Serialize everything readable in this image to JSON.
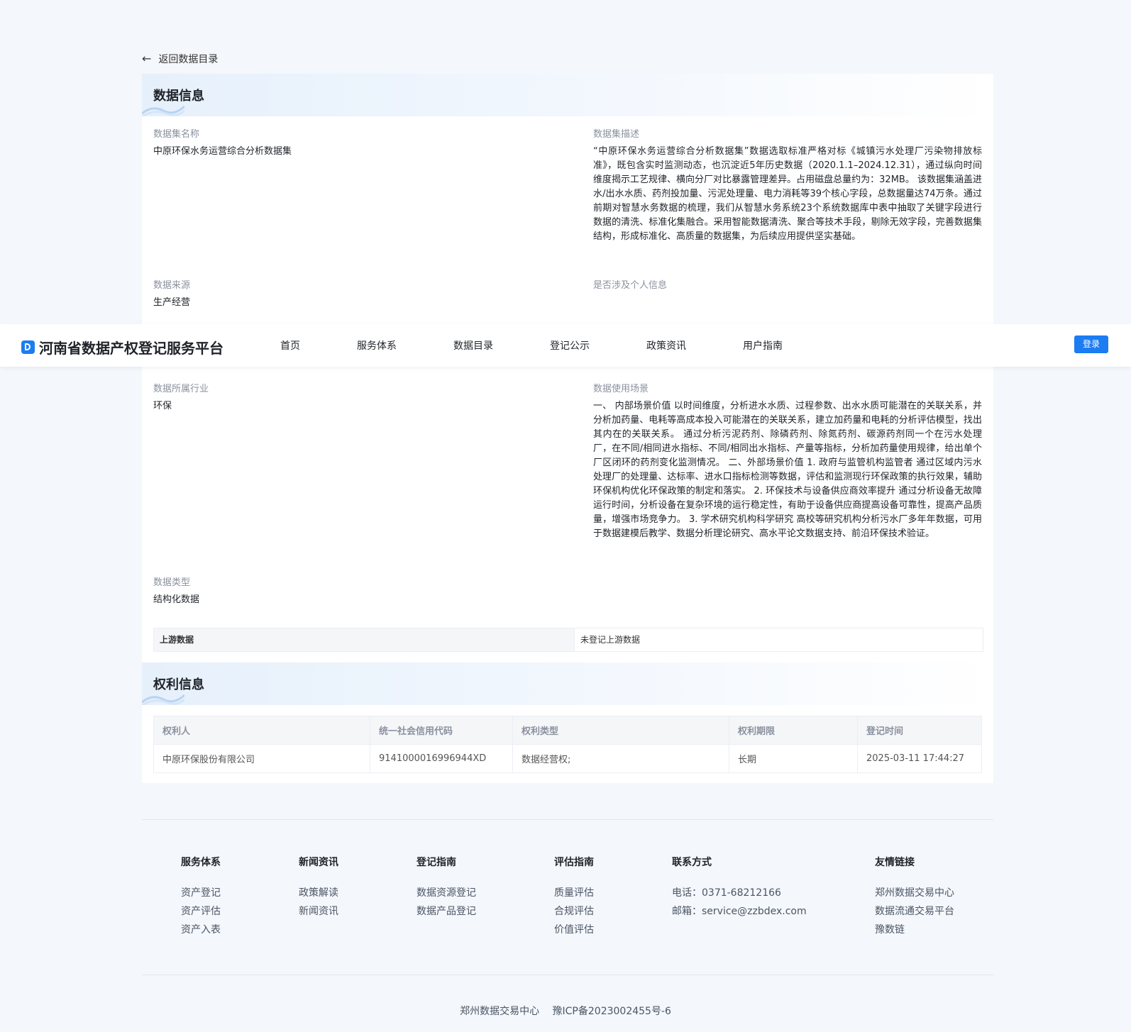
{
  "back_label": "返回数据目录",
  "data_info": {
    "title": "数据信息",
    "fields": {
      "dataset_name": {
        "label": "数据集名称",
        "value": "中原环保水务运营综合分析数据集"
      },
      "dataset_desc": {
        "label": "数据集描述",
        "value": "“中原环保水务运营综合分析数据集”数据选取标准严格对标《城镇污水处理厂污染物排放标准》，既包含实时监测动态，也沉淀近5年历史数据（2020.1.1–2024.12.31），通过纵向时间维度揭示工艺规律、横向分厂对比暴露管理差异。占用磁盘总量约为：32MB。 该数据集涵盖进水/出水水质、药剂投加量、污泥处理量、电力消耗等39个核心字段，总数据量达74万条。通过前期对智慧水务数据的梳理，我们从智慧水务系统23个系统数据库中表中抽取了关键字段进行数据的清洗、标准化集融合。采用智能数据清洗、聚合等技术手段，剔除无效字段，完善数据集结构，形成标准化、高质量的数据集，为后续应用提供坚实基础。"
      },
      "data_source": {
        "label": "数据来源",
        "value": "生产经营"
      },
      "personal_info": {
        "label": "是否涉及个人信息",
        "value": ""
      },
      "industry": {
        "label": "数据所属行业",
        "value": "环保"
      },
      "usage": {
        "label": "数据使用场景",
        "value": "一、 内部场景价值 以时间维度，分析进水水质、过程参数、出水水质可能潜在的关联关系，并分析加药量、电耗等高成本投入可能潜在的关联关系，建立加药量和电耗的分析评估模型，找出其内在的关联关系。 通过分析污泥药剂、除磷药剂、除氮药剂、碳源药剂同一个在污水处理厂，在不同/相同进水指标、不同/相同出水指标、产量等指标，分析加药量使用规律，给出单个厂区闭环的药剂变化监测情况。 二、外部场景价值 1. 政府与监管机构监管者 通过区域内污水处理厂的处理量、达标率、进水口指标检测等数据，评估和监测现行环保政策的执行效果，辅助环保机构优化环保政策的制定和落实。 2. 环保技术与设备供应商效率提升 通过分析设备无故障运行时间，分析设备在复杂环境的运行稳定性，有助于设备供应商提高设备可靠性，提高产品质量，增强市场竞争力。 3. 学术研究机构科学研究 高校等研究机构分析污水厂多年年数据，可用于数据建模后教学、数据分析理论研究、高水平论文数据支持、前沿环保技术验证。"
      },
      "data_type": {
        "label": "数据类型",
        "value": "结构化数据"
      }
    },
    "upstream": {
      "label": "上游数据",
      "value": "未登记上游数据"
    }
  },
  "rights_info": {
    "title": "权利信息",
    "columns": [
      "权利人",
      "统一社会信用代码",
      "权利类型",
      "权利期限",
      "登记时间"
    ],
    "rows": [
      [
        "中原环保股份有限公司",
        "9141000016996944XD",
        "数据经营权;",
        "长期",
        "2025-03-11 17:44:27"
      ]
    ]
  },
  "navbar": {
    "logo_text": "河南省数据产权登记服务平台",
    "items": [
      "首页",
      "服务体系",
      "数据目录",
      "登记公示",
      "政策资讯",
      "用户指南"
    ],
    "login_label": "登录"
  },
  "footer": {
    "columns": [
      {
        "title": "服务体系",
        "items": [
          "资产登记",
          "资产评估",
          "资产入表"
        ]
      },
      {
        "title": "新闻资讯",
        "items": [
          "政策解读",
          "新闻资讯"
        ]
      },
      {
        "title": "登记指南",
        "items": [
          "数据资源登记",
          "数据产品登记"
        ]
      },
      {
        "title": "评估指南",
        "items": [
          "质量评估",
          "合规评估",
          "价值评估"
        ]
      },
      {
        "title": "联系方式",
        "items": [
          "电话：0371-68212166",
          "邮箱：service@zzbdex.com"
        ]
      },
      {
        "title": "友情链接",
        "items": [
          "郑州数据交易中心",
          "数据流通交易平台",
          "豫数链"
        ]
      }
    ],
    "copyright_org": "郑州数据交易中心",
    "icp": "豫ICP备2023002455号-6"
  },
  "colors": {
    "brand": "#1c7cf2",
    "page_bg": "#f4f7fb",
    "label": "#8a919f"
  }
}
